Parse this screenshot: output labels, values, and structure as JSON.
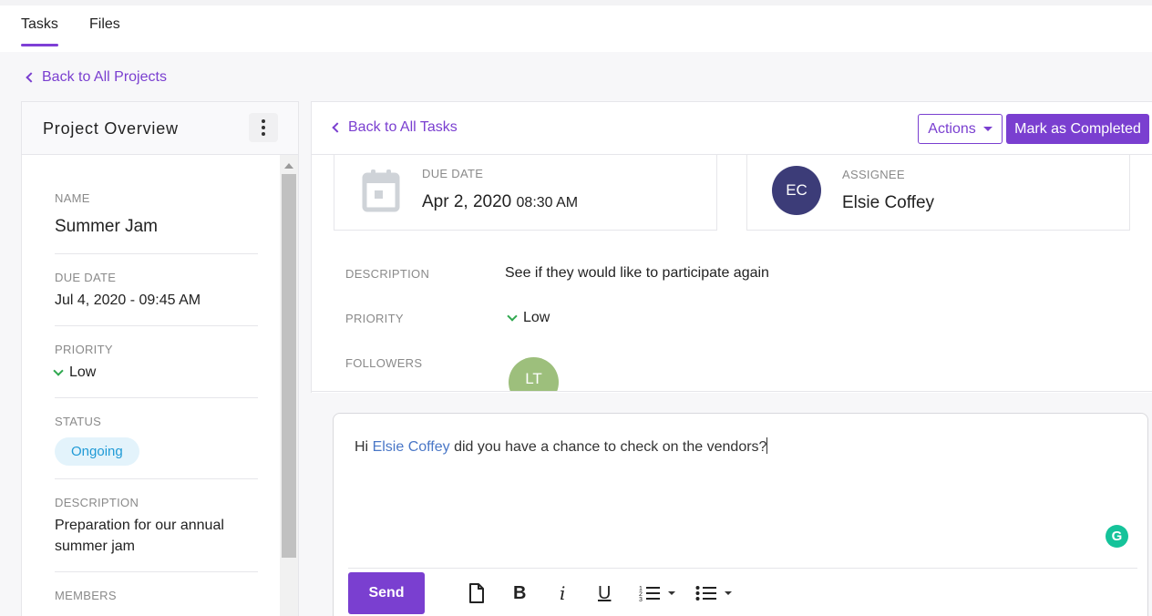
{
  "tabs": [
    {
      "label": "Tasks",
      "active": true
    },
    {
      "label": "Files",
      "active": false
    }
  ],
  "back_to_projects": "Back to All Projects",
  "project_overview": {
    "title": "Project Overview",
    "name_label": "NAME",
    "name_value": "Summer Jam",
    "due_label": "DUE DATE",
    "due_value": "Jul 4, 2020 - 09:45 AM",
    "priority_label": "PRIORITY",
    "priority_value": "Low",
    "status_label": "STATUS",
    "status_value": "Ongoing",
    "description_label": "DESCRIPTION",
    "description_value": "Preparation for our annual summer jam",
    "members_label": "MEMBERS"
  },
  "task": {
    "back_to_tasks": "Back to All Tasks",
    "actions_label": "Actions",
    "complete_label": "Mark as Completed",
    "due_label": "DUE DATE",
    "due_date": "Apr 2, 2020",
    "due_time": "08:30 AM",
    "assignee_label": "ASSIGNEE",
    "assignee_initials": "EC",
    "assignee_name": "Elsie Coffey",
    "description_label": "DESCRIPTION",
    "description_value": "See if they would like to participate again",
    "priority_label": "PRIORITY",
    "priority_value": "Low",
    "followers_label": "FOLLOWERS",
    "follower_initials": "LT"
  },
  "editor": {
    "message_prefix": "Hi",
    "mention": "Elsie Coffey",
    "message_suffix": "did you have a chance to check on the vendors?",
    "send_label": "Send",
    "grammarly_letter": "G",
    "bold": "B",
    "italic": "i",
    "underline": "U"
  },
  "colors": {
    "accent": "#7a3fd0",
    "status_text": "#1f9ad6",
    "status_bg": "#e3f3fb",
    "priority_low": "#2fa84f",
    "mention": "#4a77c7"
  }
}
